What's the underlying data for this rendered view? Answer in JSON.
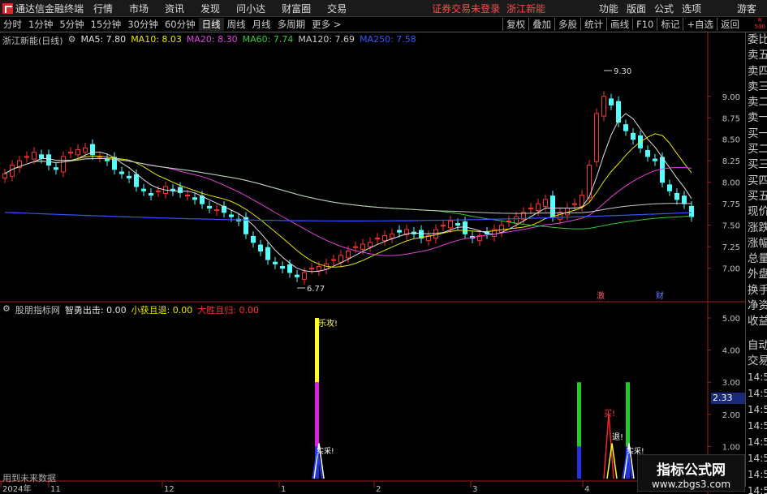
{
  "app": {
    "title": "通达信金融终端",
    "status": "证券交易未登录",
    "stock_name": "浙江新能",
    "guest": "游客"
  },
  "menu": [
    "行情",
    "市场",
    "资讯",
    "发现",
    "问小达",
    "财富圈",
    "交易"
  ],
  "right_menu": [
    "功能",
    "版面",
    "公式",
    "选项"
  ],
  "corner": {
    "top": "R",
    "bottom": "500"
  },
  "periods": [
    "分时",
    "1分钟",
    "5分钟",
    "15分钟",
    "30分钟",
    "60分钟",
    "日线",
    "周线",
    "月线",
    "多周期",
    "更多 >"
  ],
  "active_period": "日线",
  "toolbar": [
    "复权",
    "叠加",
    "多股",
    "统计",
    "画线",
    "F10",
    "标记",
    "+自选",
    "返回"
  ],
  "main_legend": {
    "title": "浙江新能(日线)",
    "items": [
      {
        "label": "MA5: 7.80",
        "color": "#e0e0e0"
      },
      {
        "label": "MA10: 8.03",
        "color": "#e6e600"
      },
      {
        "label": "MA20: 8.30",
        "color": "#e040e0"
      },
      {
        "label": "MA60: 7.74",
        "color": "#33cc33"
      },
      {
        "label": "MA120: 7.69",
        "color": "#c8c8c8"
      },
      {
        "label": "MA250: 7.58",
        "color": "#3355ff"
      }
    ]
  },
  "sub_legend": {
    "title": "股朋指标网",
    "items": [
      {
        "label": "智勇出击: 0.00",
        "color": "#e0e0e0"
      },
      {
        "label": "小获且退: 0.00",
        "color": "#e6e600"
      },
      {
        "label": "大胜且归: 0.00",
        "color": "#ff3333"
      }
    ]
  },
  "price_axis": [
    "9.00",
    "8.75",
    "8.50",
    "8.25",
    "8.00",
    "7.75",
    "7.50",
    "7.25",
    "7.00"
  ],
  "ind_axis": [
    "5.00",
    "4.00",
    "3.00",
    "2.00",
    "1.00"
  ],
  "highlight_value": "2.33",
  "x_axis": [
    "2024年",
    "11",
    "12",
    "1",
    "2",
    "3",
    "4"
  ],
  "annotations": {
    "high": "9.30",
    "low": "6.77",
    "event1": "激",
    "event2": "财",
    "sig_attack": "乐攻!",
    "sig_buy": "买!",
    "sig_retreat": "退!",
    "sig_enter1": "实采!",
    "sig_enter2": "实采!"
  },
  "right_panel": [
    "委比",
    "卖五",
    "卖四",
    "卖三",
    "卖二",
    "卖一",
    "买一",
    "买二",
    "买三",
    "买四",
    "买五",
    "现价",
    "涨跌",
    "涨幅",
    "总量",
    "外盘",
    "换手",
    "净资",
    "收益"
  ],
  "right_panel2": [
    "自动",
    "交易"
  ],
  "times": [
    "14:56",
    "14:56",
    "14:56",
    "14:56",
    "14:56",
    "14:56",
    "14:56",
    "14:56",
    "14:56"
  ],
  "use_future": "用到未来数据",
  "watermark": {
    "line1": "指标公式网",
    "line2": "www.zbgs3.com"
  },
  "chart_data": {
    "type": "candlestick",
    "ylim": [
      6.77,
      9.3
    ],
    "closes": [
      8.1,
      8.2,
      8.25,
      8.3,
      8.35,
      8.28,
      8.2,
      8.15,
      8.3,
      8.35,
      8.38,
      8.4,
      8.32,
      8.3,
      8.25,
      8.15,
      8.1,
      8.05,
      7.95,
      7.9,
      7.85,
      7.9,
      7.95,
      7.9,
      7.88,
      7.85,
      7.8,
      7.75,
      7.7,
      7.68,
      7.65,
      7.6,
      7.55,
      7.4,
      7.3,
      7.2,
      7.1,
      7.05,
      7.0,
      6.95,
      6.9,
      6.95,
      7.0,
      7.02,
      7.05,
      7.1,
      7.15,
      7.2,
      7.25,
      7.28,
      7.3,
      7.35,
      7.38,
      7.4,
      7.42,
      7.45,
      7.4,
      7.35,
      7.38,
      7.45,
      7.5,
      7.55,
      7.5,
      7.4,
      7.35,
      7.38,
      7.4,
      7.45,
      7.5,
      7.55,
      7.6,
      7.65,
      7.7,
      7.75,
      7.8,
      7.6,
      7.65,
      7.7,
      7.75,
      7.85,
      8.2,
      8.8,
      9.0,
      8.9,
      8.7,
      8.6,
      8.5,
      8.4,
      8.3,
      8.25,
      8.0,
      7.9,
      7.8,
      7.75,
      7.6
    ]
  }
}
